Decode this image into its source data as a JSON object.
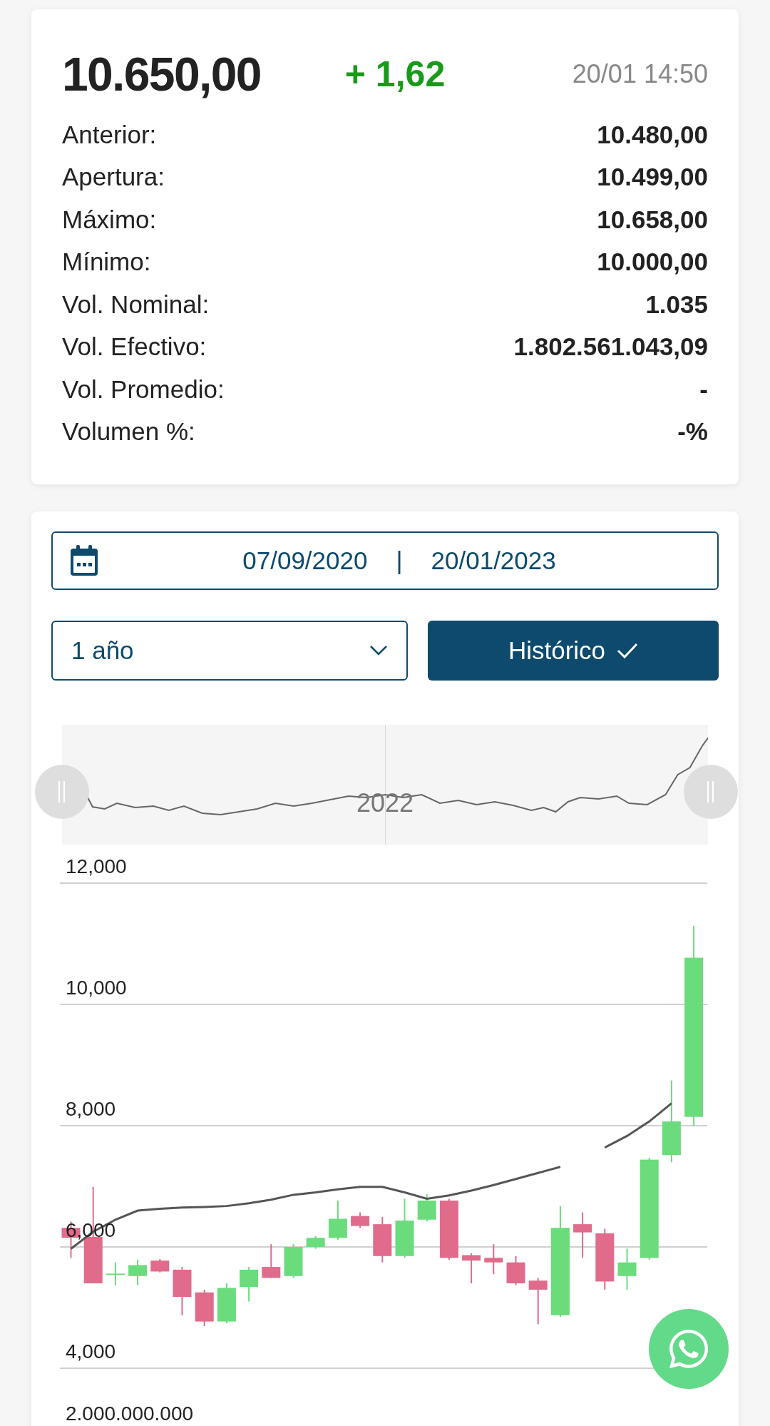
{
  "quote": {
    "price": "10.650,00",
    "change": "+ 1,62",
    "datetime": "20/01 14:50",
    "rows": [
      {
        "label": "Anterior:",
        "value": "10.480,00"
      },
      {
        "label": "Apertura:",
        "value": "10.499,00"
      },
      {
        "label": "Máximo:",
        "value": "10.658,00"
      },
      {
        "label": "Mínimo:",
        "value": "10.000,00"
      },
      {
        "label": "Vol. Nominal:",
        "value": "1.035"
      },
      {
        "label": "Vol. Efectivo:",
        "value": "1.802.561.043,09"
      },
      {
        "label": "Vol. Promedio:",
        "value": "-"
      },
      {
        "label": "Volumen %:",
        "value": "-%"
      }
    ]
  },
  "date_range": {
    "start": "07/09/2020",
    "separator": "|",
    "end": "20/01/2023"
  },
  "period_select": {
    "value": "1 año"
  },
  "historic_button": {
    "label": "Histórico",
    "checked": true
  },
  "navigator": {
    "label": "2022"
  },
  "chart": {
    "y_axis_labels": [
      "12,000",
      "10,000",
      "8,000",
      "6,000",
      "4,000"
    ]
  },
  "volume_axis": {
    "label": "2.000.000.000"
  }
}
